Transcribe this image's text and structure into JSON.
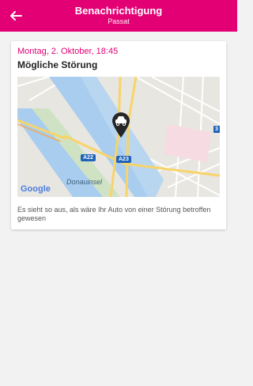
{
  "header": {
    "title": "Benachrichtigung",
    "subtitle": "Passat",
    "back_icon": "arrow-left-icon",
    "background_color": "#e20074"
  },
  "notification": {
    "date": "Montag, 2. Oktober, 18:45",
    "title": "Mögliche Störung",
    "description": "Es sieht so aus, als wäre Ihr Auto von einer Störung betroffen gewesen"
  },
  "map": {
    "labels": {
      "road_a22": "A22",
      "road_a23": "A23",
      "area_donauinsel": "Donauinsel",
      "badge_3": "3",
      "google": "Google"
    },
    "pin_icon": "car-pin-icon"
  }
}
